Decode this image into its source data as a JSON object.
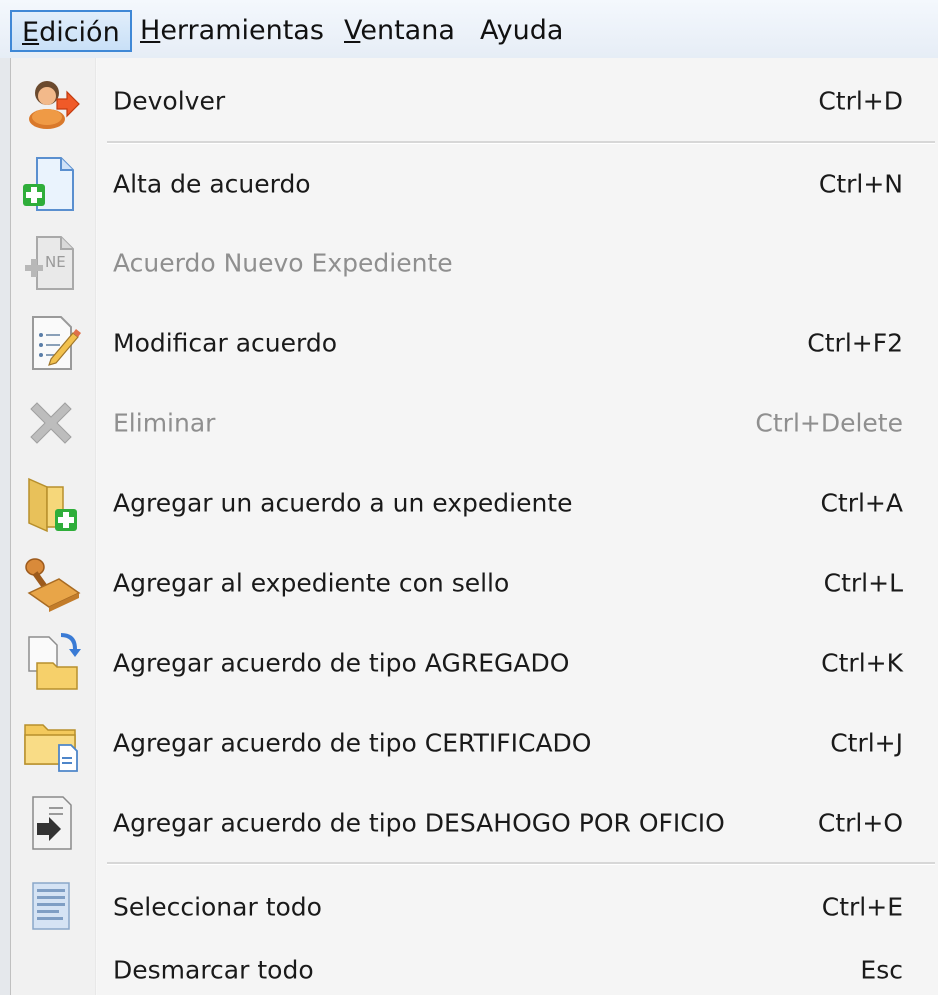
{
  "menubar": {
    "items": [
      {
        "accel": "E",
        "rest": "dición"
      },
      {
        "accel": "H",
        "rest": "erramientas"
      },
      {
        "accel": "V",
        "rest": "entana"
      },
      {
        "accel": "",
        "rest": "Ayuda"
      }
    ]
  },
  "menu": {
    "items": [
      {
        "label": "Devolver",
        "shortcut": "Ctrl+D",
        "icon": "user-arrow-icon",
        "enabled": true
      },
      {
        "label": "Alta de acuerdo",
        "shortcut": "Ctrl+N",
        "icon": "new-document-icon",
        "enabled": true
      },
      {
        "label": "Acuerdo Nuevo Expediente",
        "shortcut": "",
        "icon": "ne-document-icon",
        "enabled": false
      },
      {
        "label": "Modificar acuerdo",
        "shortcut": "Ctrl+F2",
        "icon": "edit-document-icon",
        "enabled": true
      },
      {
        "label": "Eliminar",
        "shortcut": "Ctrl+Delete",
        "icon": "delete-x-icon",
        "enabled": false
      },
      {
        "label": "Agregar un acuerdo a un expediente",
        "shortcut": "Ctrl+A",
        "icon": "folder-add-icon",
        "enabled": true
      },
      {
        "label": "Agregar al expediente con sello",
        "shortcut": "Ctrl+L",
        "icon": "stamp-icon",
        "enabled": true
      },
      {
        "label": "Agregar acuerdo de tipo AGREGADO",
        "shortcut": "Ctrl+K",
        "icon": "document-to-folder-icon",
        "enabled": true
      },
      {
        "label": "Agregar acuerdo de tipo CERTIFICADO",
        "shortcut": "Ctrl+J",
        "icon": "folder-document-icon",
        "enabled": true
      },
      {
        "label": "Agregar acuerdo de tipo DESAHOGO POR OFICIO",
        "shortcut": "Ctrl+O",
        "icon": "document-arrow-icon",
        "enabled": true
      },
      {
        "label": "Seleccionar todo",
        "shortcut": "Ctrl+E",
        "icon": "select-all-icon",
        "enabled": true
      },
      {
        "label": "Desmarcar todo",
        "shortcut": "Esc",
        "icon": "",
        "enabled": true
      }
    ]
  }
}
